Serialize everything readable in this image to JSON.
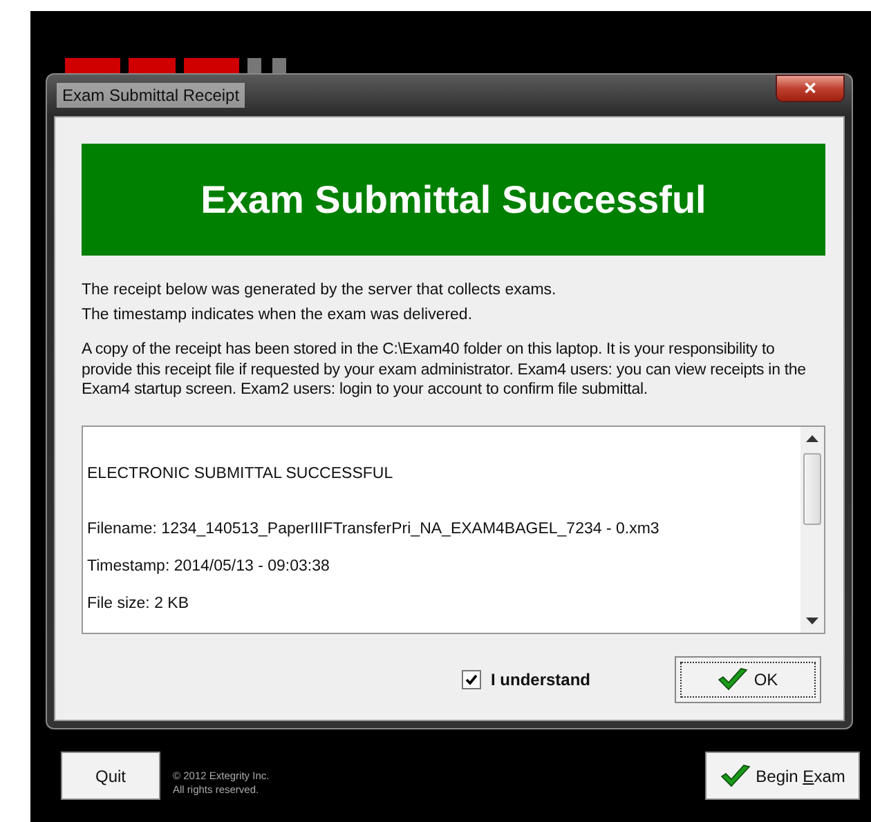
{
  "dialog": {
    "title": "Exam Submittal Receipt",
    "close_label": "✕"
  },
  "banner": "Exam Submittal Successful",
  "intro_lines": [
    "The receipt below was generated by the server that collects exams.",
    "The timestamp indicates when the exam was delivered."
  ],
  "note": "A copy of the receipt has been stored in the C:\\Exam40 folder on this laptop. It is your responsibility to provide this receipt file if requested by your exam administrator. Exam4 users: you can view receipts in the Exam4 startup screen. Exam2 users: login to your account to confirm file submittal.",
  "receipt_lines": [
    "ELECTRONIC SUBMITTAL SUCCESSFUL",
    "Filename: 1234_140513_PaperIIIFTransferPri_NA_EXAM4BAGEL_7234 - 0.xm3",
    "Timestamp: 2014/05/13 - 09:03:38",
    "File size: 2 KB"
  ],
  "understand": {
    "label": "I understand",
    "checked": true
  },
  "ok_button": {
    "label": "OK"
  },
  "quit_button": {
    "label": "Quit"
  },
  "copyright": [
    "© 2012 Extegrity Inc.",
    "All rights reserved."
  ],
  "begin_button": {
    "label_start": "Begin ",
    "access_key": "E",
    "label_end": "xam"
  }
}
